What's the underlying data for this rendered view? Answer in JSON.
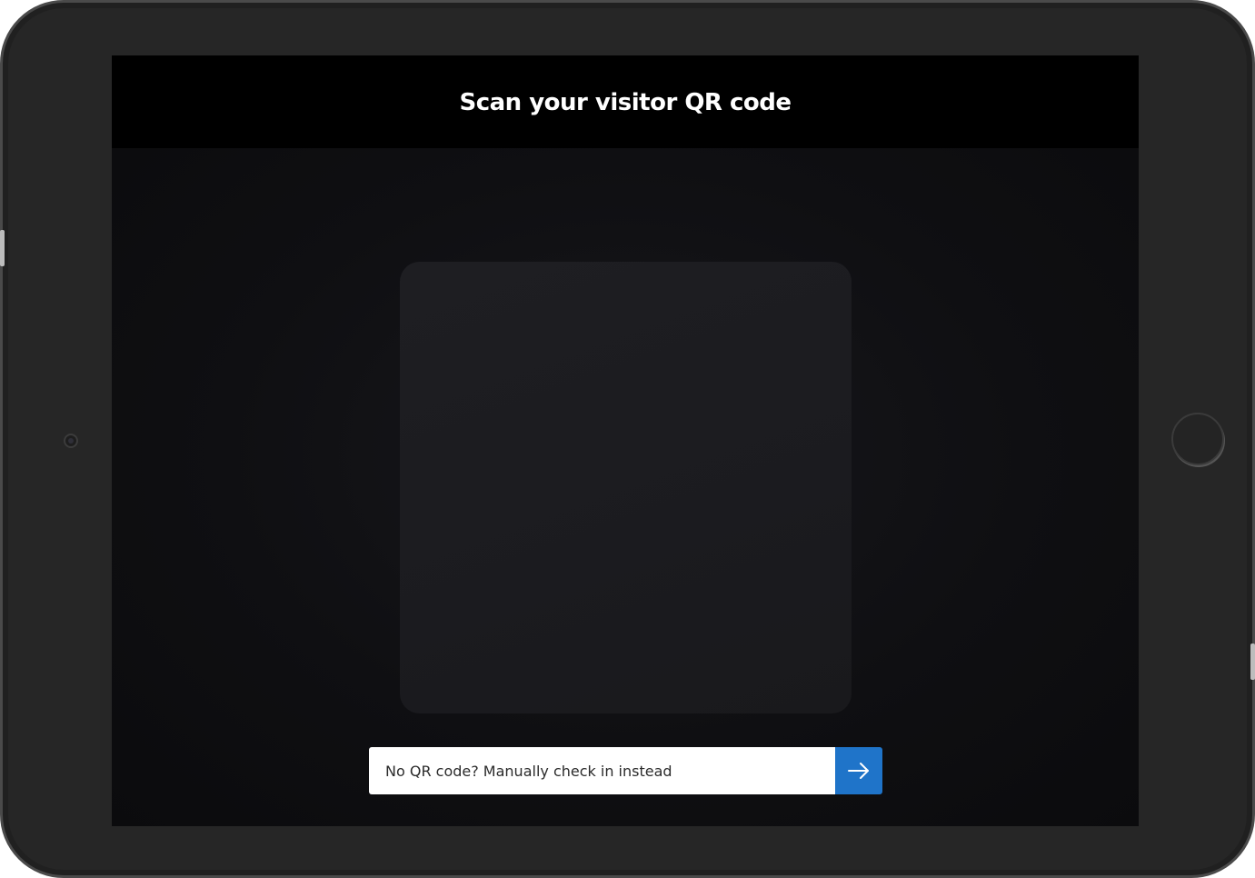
{
  "screen": {
    "title": "Scan your visitor QR code"
  },
  "manual_checkin": {
    "label": "No QR code? Manually check in instead",
    "button_icon": "arrow-right-icon"
  },
  "colors": {
    "accent": "#1f74c9",
    "header_bg": "#000000",
    "device_bezel": "#262626"
  }
}
